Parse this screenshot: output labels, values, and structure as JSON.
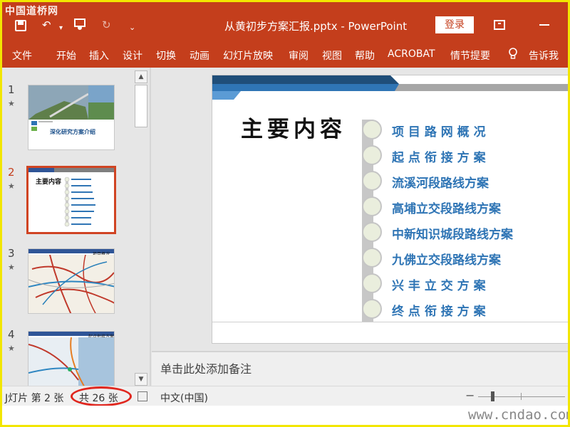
{
  "app": {
    "watermark_top": "中国道桥网",
    "watermark_bottom": "www.cndao.com",
    "document_title": "从黄初步方案汇报.pptx - PowerPoint",
    "login_label": "登录",
    "accent_color": "#c43e1c"
  },
  "quick_access": {
    "save_icon": "save-icon",
    "undo_icon": "undo-icon",
    "present_icon": "present-from-start-icon",
    "redo_icon": "redo-icon",
    "customize_icon": "customize-qat-icon"
  },
  "ribbon": {
    "tabs": [
      "文件",
      "开始",
      "插入",
      "设计",
      "切换",
      "动画",
      "幻灯片放映",
      "审阅",
      "视图",
      "帮助",
      "ACROBAT",
      "情节提要"
    ],
    "tell_me": "告诉我"
  },
  "thumbnails": [
    {
      "number": "1",
      "star": "★",
      "subtitle": "深化研究方案介绍"
    },
    {
      "number": "2",
      "star": "★",
      "title": "主要内容"
    },
    {
      "number": "3",
      "star": "★",
      "header": "项目概况"
    },
    {
      "number": "4",
      "star": "★",
      "header": "起点衔接方案"
    }
  ],
  "slide": {
    "title": "主要内容",
    "items": [
      "项 目 路 网 概 况",
      "起 点 衔 接 方 案",
      "流溪河段路线方案",
      "高埔立交段路线方案",
      "中新知识城段路线方案",
      "九佛立交段路线方案",
      "兴 丰 立 交 方 案",
      "终 点 衔 接 方 案"
    ]
  },
  "notes": {
    "placeholder": "单击此处添加备注"
  },
  "status": {
    "slide_indicator": "J灯片 第 2 张",
    "total": "共 26 张",
    "language": "中文(中国)"
  }
}
